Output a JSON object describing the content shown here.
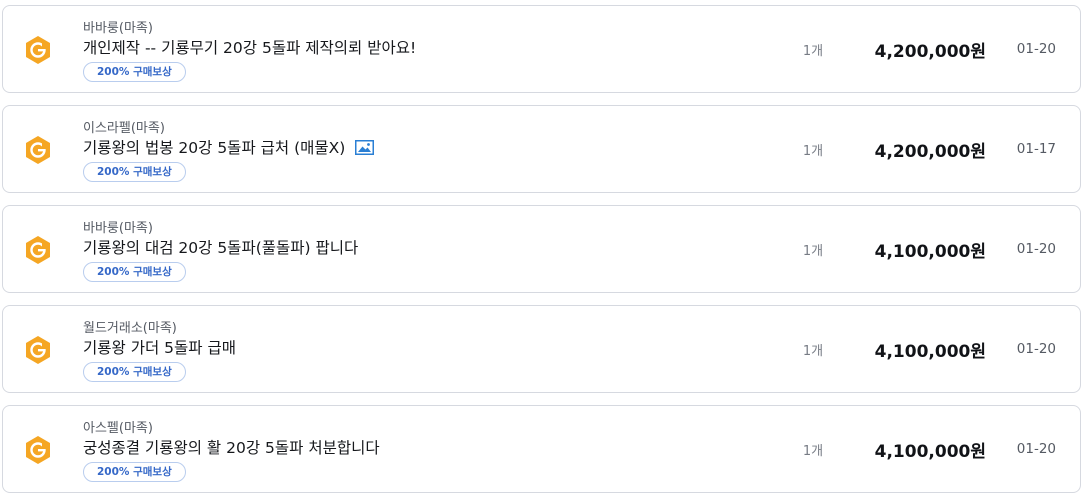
{
  "listings": [
    {
      "seller": "바바룽(마족)",
      "title": "개인제작 -- 기룡무기 20강 5돌파 제작의뢰 받아요!",
      "has_image": false,
      "reward": "200% 구매보상",
      "quantity": "1개",
      "price": "4,200,000원",
      "date": "01-20"
    },
    {
      "seller": "이스라펠(마족)",
      "title": "기룡왕의 법봉 20강 5돌파 급처 (매물X)",
      "has_image": true,
      "reward": "200% 구매보상",
      "quantity": "1개",
      "price": "4,200,000원",
      "date": "01-17"
    },
    {
      "seller": "바바룽(마족)",
      "title": "기룡왕의 대검 20강 5돌파(풀돌파) 팝니다",
      "has_image": false,
      "reward": "200% 구매보상",
      "quantity": "1개",
      "price": "4,100,000원",
      "date": "01-20"
    },
    {
      "seller": "월드거래소(마족)",
      "title": "기룡왕 가더 5돌파 급매",
      "has_image": false,
      "reward": "200% 구매보상",
      "quantity": "1개",
      "price": "4,100,000원",
      "date": "01-20"
    },
    {
      "seller": "아스펠(마족)",
      "title": "궁성종결 기룡왕의 활 20강 5돌파 처분합니다",
      "has_image": false,
      "reward": "200% 구매보상",
      "quantity": "1개",
      "price": "4,100,000원",
      "date": "01-20"
    }
  ],
  "icons": {
    "badge": "game-money-badge-icon",
    "image": "image-attachment-icon"
  },
  "colors": {
    "badge_orange": "#f5a623",
    "reward_blue": "#3568c8",
    "card_border": "#d6d9e0"
  }
}
